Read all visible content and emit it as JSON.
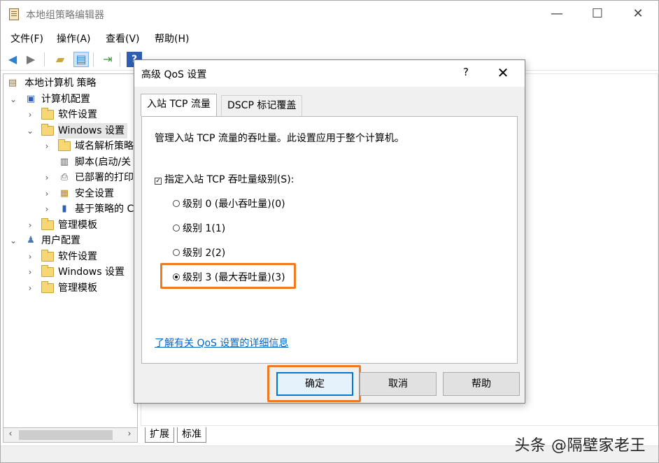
{
  "window": {
    "title": "本地组策略编辑器",
    "minimize": "—",
    "maximize": "☐",
    "close": "✕"
  },
  "menu": [
    "文件(F)",
    "操作(A)",
    "查看(V)",
    "帮助(H)"
  ],
  "toolbar": {
    "icons": [
      "back-arrow-icon",
      "forward-arrow-icon",
      "up-folder-icon",
      "show-hide-tree-icon",
      "export-list-icon",
      "help-icon",
      "properties-icon"
    ]
  },
  "tree": {
    "items": [
      {
        "label": "本地计算机 策略",
        "twisty": "",
        "icon": "policy-icon"
      },
      {
        "label": "计算机配置",
        "twisty": "⌄",
        "icon": "computer-icon"
      },
      {
        "label": "软件设置",
        "twisty": "›",
        "icon": "folder-icon"
      },
      {
        "label": "Windows 设置",
        "twisty": "⌄",
        "icon": "folder-icon"
      },
      {
        "label": "域名解析策略",
        "twisty": "›",
        "icon": "folder-icon"
      },
      {
        "label": "脚本(启动/关",
        "twisty": "",
        "icon": "script-icon"
      },
      {
        "label": "已部署的打印",
        "twisty": "›",
        "icon": "printer-icon"
      },
      {
        "label": "安全设置",
        "twisty": "›",
        "icon": "security-icon"
      },
      {
        "label": "基于策略的 C",
        "twisty": "›",
        "icon": "chart-icon"
      },
      {
        "label": "管理模板",
        "twisty": "›",
        "icon": "folder-icon"
      },
      {
        "label": "用户配置",
        "twisty": "⌄",
        "icon": "user-icon"
      },
      {
        "label": "软件设置",
        "twisty": "›",
        "icon": "folder-icon"
      },
      {
        "label": "Windows 设置",
        "twisty": "›",
        "icon": "folder-icon"
      },
      {
        "label": "管理模板",
        "twisty": "›",
        "icon": "folder-icon"
      }
    ],
    "scroll_left": "‹",
    "scroll_right": "›"
  },
  "bottom_tabs": [
    "扩展",
    "标准"
  ],
  "watermark": "头条 @隔壁家老王",
  "dialog": {
    "title": "高级 QoS 设置",
    "help": "?",
    "close": "✕",
    "tabs": [
      "入站 TCP 流量",
      "DSCP 标记覆盖"
    ],
    "description": "管理入站 TCP 流量的吞吐量。此设置应用于整个计算机。",
    "checkbox_label": "指定入站 TCP 吞吐量级别(S):",
    "checkbox_checked": true,
    "radios": [
      {
        "label": "级别 0 (最小吞吐量)(0)",
        "selected": false
      },
      {
        "label": "级别 1(1)",
        "selected": false
      },
      {
        "label": "级别 2(2)",
        "selected": false
      },
      {
        "label": "级别 3 (最大吞吐量)(3)",
        "selected": true
      }
    ],
    "link": "了解有关 QoS 设置的详细信息",
    "buttons": {
      "ok": "确定",
      "cancel": "取消",
      "help": "帮助"
    }
  },
  "colors": {
    "highlight": "#f07a22",
    "link": "#0066cc",
    "default_button_border": "#0078d7"
  }
}
